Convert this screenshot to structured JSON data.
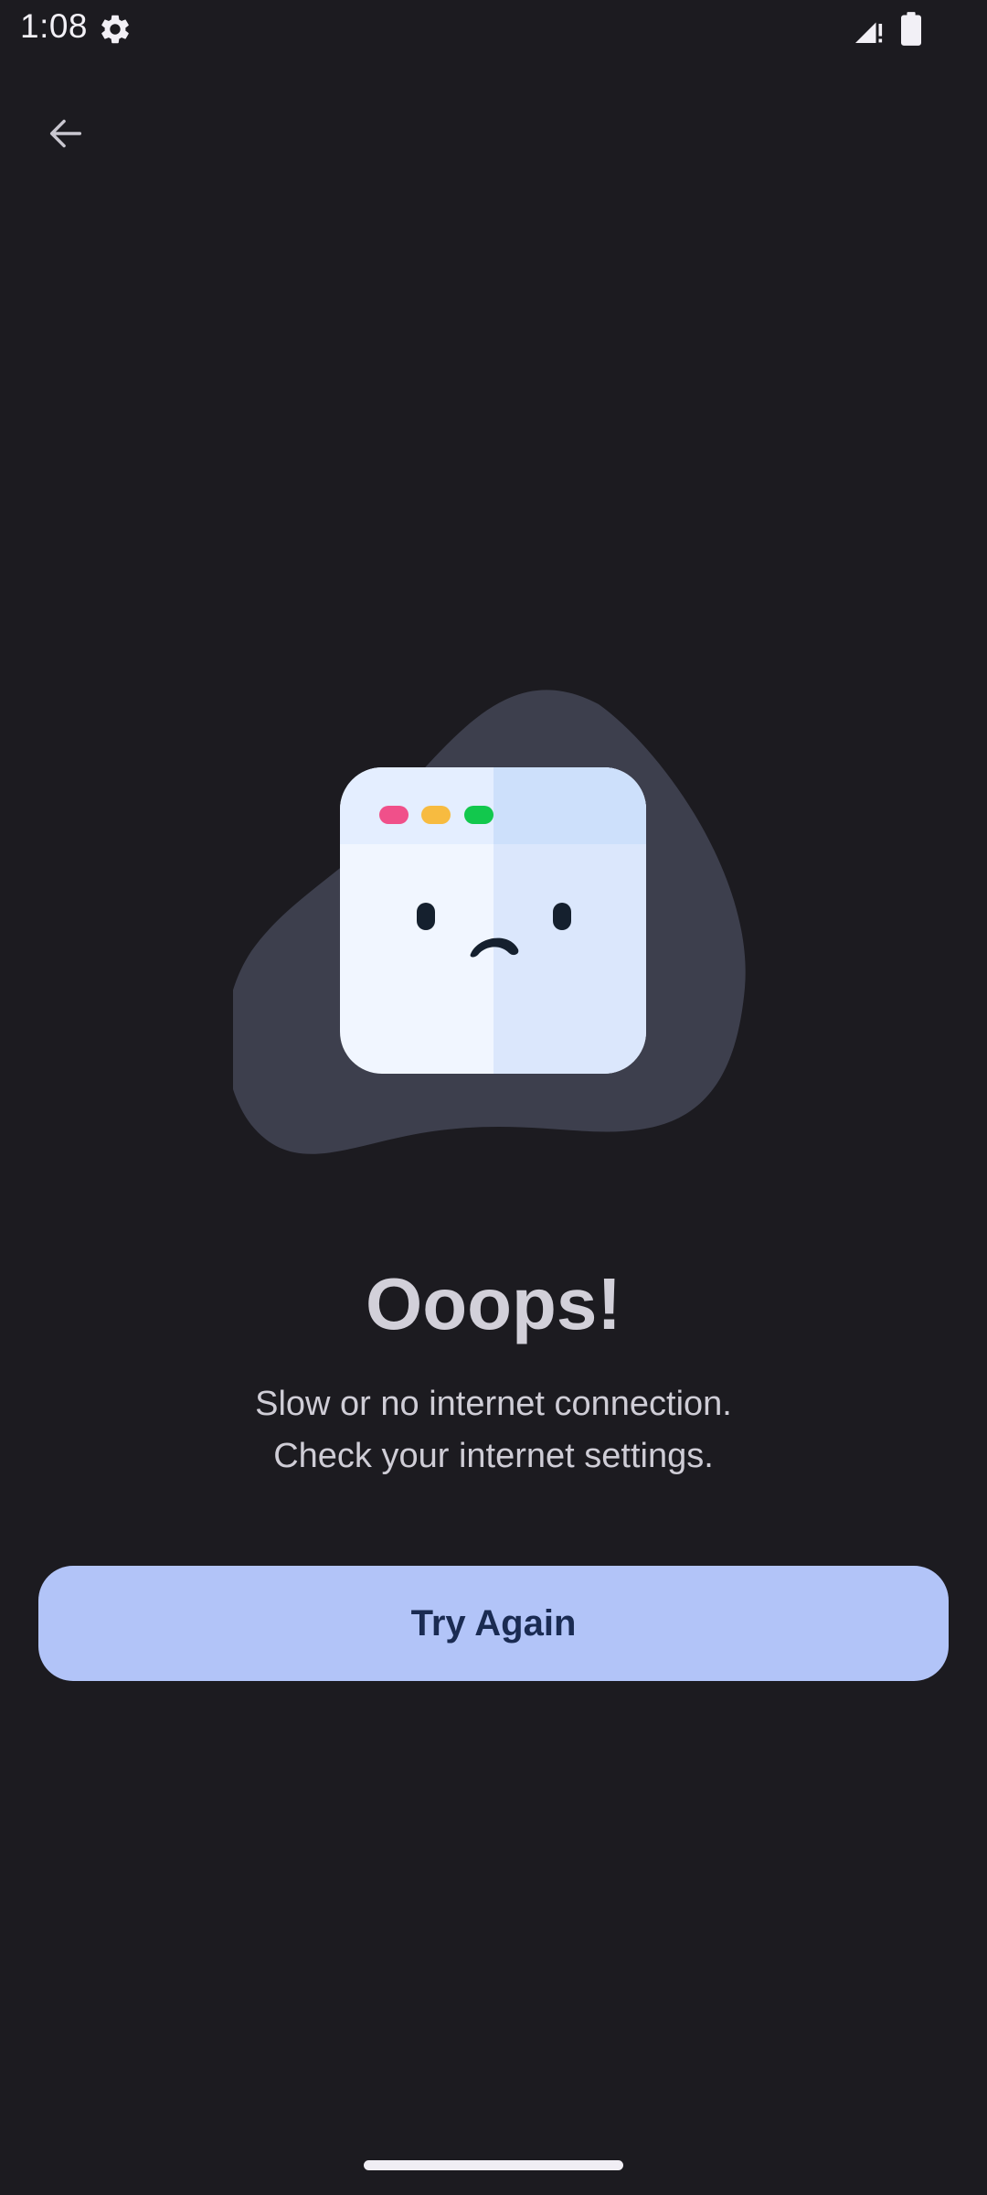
{
  "status_bar": {
    "time": "1:08",
    "icons": [
      "settings-icon",
      "signal-icon",
      "battery-icon"
    ]
  },
  "nav": {
    "back_icon": "arrow-left-icon"
  },
  "error": {
    "title": "Ooops!",
    "message_line1": "Slow or no internet connection.",
    "message_line2": "Check your internet settings."
  },
  "actions": {
    "try_again_label": "Try Again"
  },
  "colors": {
    "background": "#1c1b20",
    "button_bg": "#b2c4f8",
    "button_text": "#1a2b52",
    "blob": "#3d3f4d",
    "window_light": "#f1f6ff",
    "window_shade": "#d9e6fc",
    "dot_pink": "#f0508a",
    "dot_yellow": "#f7bb40",
    "dot_green": "#12c84d"
  }
}
